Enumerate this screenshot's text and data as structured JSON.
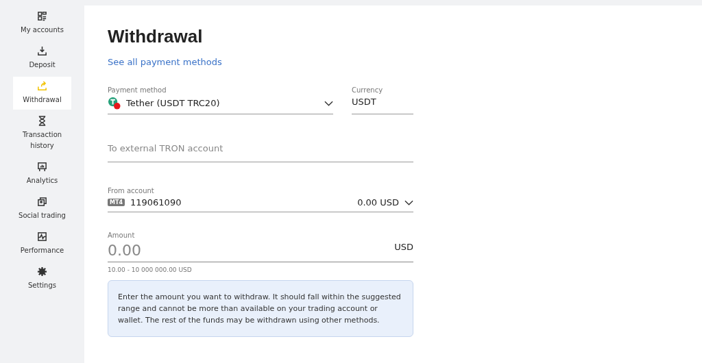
{
  "sidebar": {
    "items": [
      {
        "label": "My accounts",
        "selected": false
      },
      {
        "label": "Deposit",
        "selected": false
      },
      {
        "label": "Withdrawal",
        "selected": true
      },
      {
        "label": "Transaction history",
        "selected": false
      },
      {
        "label": "Analytics",
        "selected": false
      },
      {
        "label": "Social trading",
        "selected": false
      },
      {
        "label": "Performance",
        "selected": false
      },
      {
        "label": "Settings",
        "selected": false
      }
    ]
  },
  "page": {
    "title": "Withdrawal",
    "link": "See all payment methods"
  },
  "payment_method": {
    "label": "Payment method",
    "value": "Tether (USDT TRC20)"
  },
  "currency": {
    "label": "Currency",
    "value": "USDT"
  },
  "destination": {
    "placeholder": "To external TRON account"
  },
  "from_account": {
    "label": "From account",
    "badge": "MT4",
    "value": "119061090",
    "balance": "0.00 USD"
  },
  "amount": {
    "label": "Amount",
    "placeholder": "0.00",
    "unit": "USD",
    "range": "10.00 - 10 000 000.00 USD"
  },
  "info": "Enter the amount you want to withdraw. It should fall within the suggested range and cannot be more than available on your trading account or wallet. The rest of the funds may be withdrawn using other methods."
}
